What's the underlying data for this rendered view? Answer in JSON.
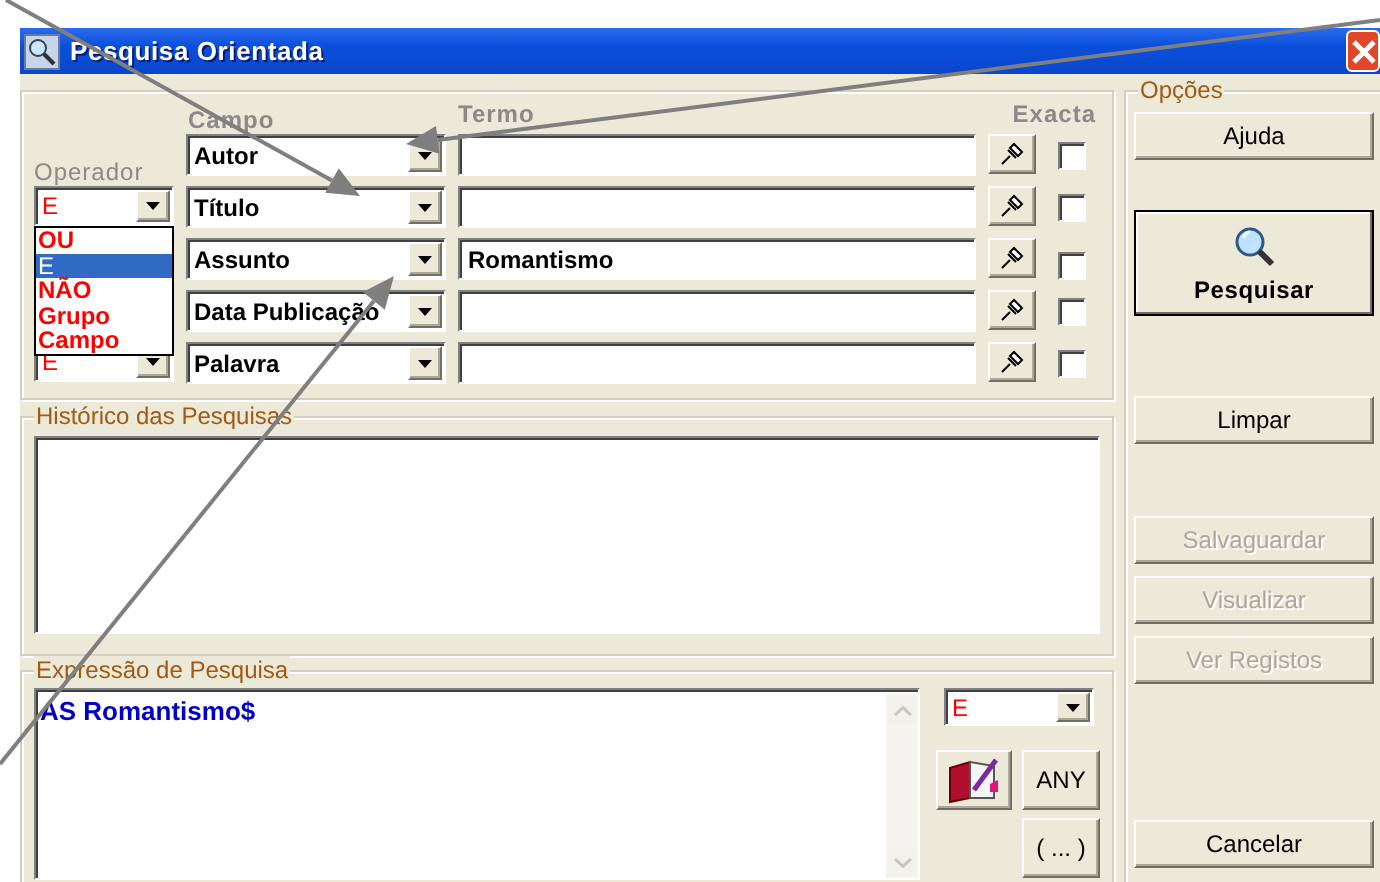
{
  "window": {
    "title": "Pesquisa Orientada"
  },
  "criteria": {
    "operator_label": "Operador",
    "field_label": "Campo",
    "term_label": "Termo",
    "exact_label": "Exacta",
    "rows": [
      {
        "field": "Autor",
        "exact": false
      },
      {
        "operator": "E",
        "field": "Título",
        "exact": false
      },
      {
        "field": "Assunto",
        "term": "Romantismo",
        "exact": false
      },
      {
        "field": "Data Publicação",
        "exact": false
      },
      {
        "operator": "E",
        "field": "Palavra",
        "exact": false
      }
    ]
  },
  "operator_list": {
    "options": [
      {
        "label": "OU",
        "selected": false
      },
      {
        "label": "E",
        "selected": true
      },
      {
        "label": "NÃO",
        "selected": false
      },
      {
        "label": "Grupo",
        "selected": false
      },
      {
        "label": "Campo",
        "selected": false
      }
    ]
  },
  "history": {
    "title": "Histórico das Pesquisas"
  },
  "expression": {
    "title": "Expressão de Pesquisa",
    "value": "AS Romantismo$",
    "operator": "E",
    "buttons": [
      "ANY",
      "( ... )"
    ]
  },
  "options": {
    "title": "Opções",
    "buttons": [
      {
        "label": "Ajuda",
        "kind": "normal",
        "disabled": false
      },
      {
        "label": "Pesquisar",
        "kind": "search",
        "disabled": false
      },
      {
        "label": "Limpar",
        "kind": "normal",
        "disabled": false
      },
      {
        "label": "Salvaguardar",
        "kind": "normal",
        "disabled": true
      },
      {
        "label": "Visualizar",
        "kind": "normal",
        "disabled": true
      },
      {
        "label": "Ver Registos",
        "kind": "normal",
        "disabled": true
      },
      {
        "label": "Cancelar",
        "kind": "normal",
        "disabled": false
      }
    ]
  }
}
